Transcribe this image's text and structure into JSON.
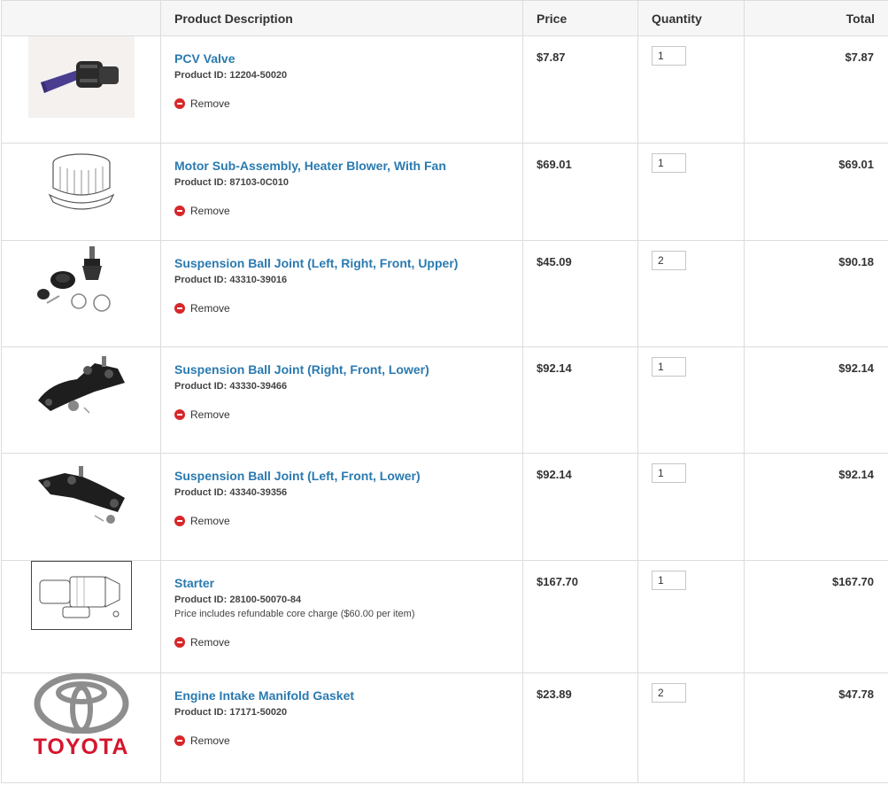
{
  "header": {
    "image_col": "",
    "description_col": "Product Description",
    "price_col": "Price",
    "quantity_col": "Quantity",
    "total_col": "Total"
  },
  "remove_label": "Remove",
  "colors": {
    "link": "#2a7ab0",
    "remove_icon": "#d7272a",
    "brand_red": "#d5162e"
  },
  "items": [
    {
      "name": "PCV Valve",
      "product_id": "Product ID: 12204-50020",
      "note": "",
      "price": "$7.87",
      "quantity": "1",
      "total": "$7.87",
      "image": "pcv-valve-image"
    },
    {
      "name": "Motor Sub-Assembly, Heater Blower, With Fan",
      "product_id": "Product ID: 87103-0C010",
      "note": "",
      "price": "$69.01",
      "quantity": "1",
      "total": "$69.01",
      "image": "blower-motor-drawing"
    },
    {
      "name": "Suspension Ball Joint (Left, Right, Front, Upper)",
      "product_id": "Product ID: 43310-39016",
      "note": "",
      "price": "$45.09",
      "quantity": "2",
      "total": "$90.18",
      "image": "upper-ball-joint-image"
    },
    {
      "name": "Suspension Ball Joint (Right, Front, Lower)",
      "product_id": "Product ID: 43330-39466",
      "note": "",
      "price": "$92.14",
      "quantity": "1",
      "total": "$92.14",
      "image": "lower-ball-joint-right-image"
    },
    {
      "name": "Suspension Ball Joint (Left, Front, Lower)",
      "product_id": "Product ID: 43340-39356",
      "note": "",
      "price": "$92.14",
      "quantity": "1",
      "total": "$92.14",
      "image": "lower-ball-joint-left-image"
    },
    {
      "name": "Starter",
      "product_id": "Product ID: 28100-50070-84",
      "note": "Price includes refundable core charge ($60.00 per item)",
      "price": "$167.70",
      "quantity": "1",
      "total": "$167.70",
      "image": "starter-drawing"
    },
    {
      "name": "Engine Intake Manifold Gasket",
      "product_id": "Product ID: 17171-50020",
      "note": "",
      "price": "$23.89",
      "quantity": "2",
      "total": "$47.78",
      "image": "toyota-logo",
      "brand": "TOYOTA"
    }
  ]
}
